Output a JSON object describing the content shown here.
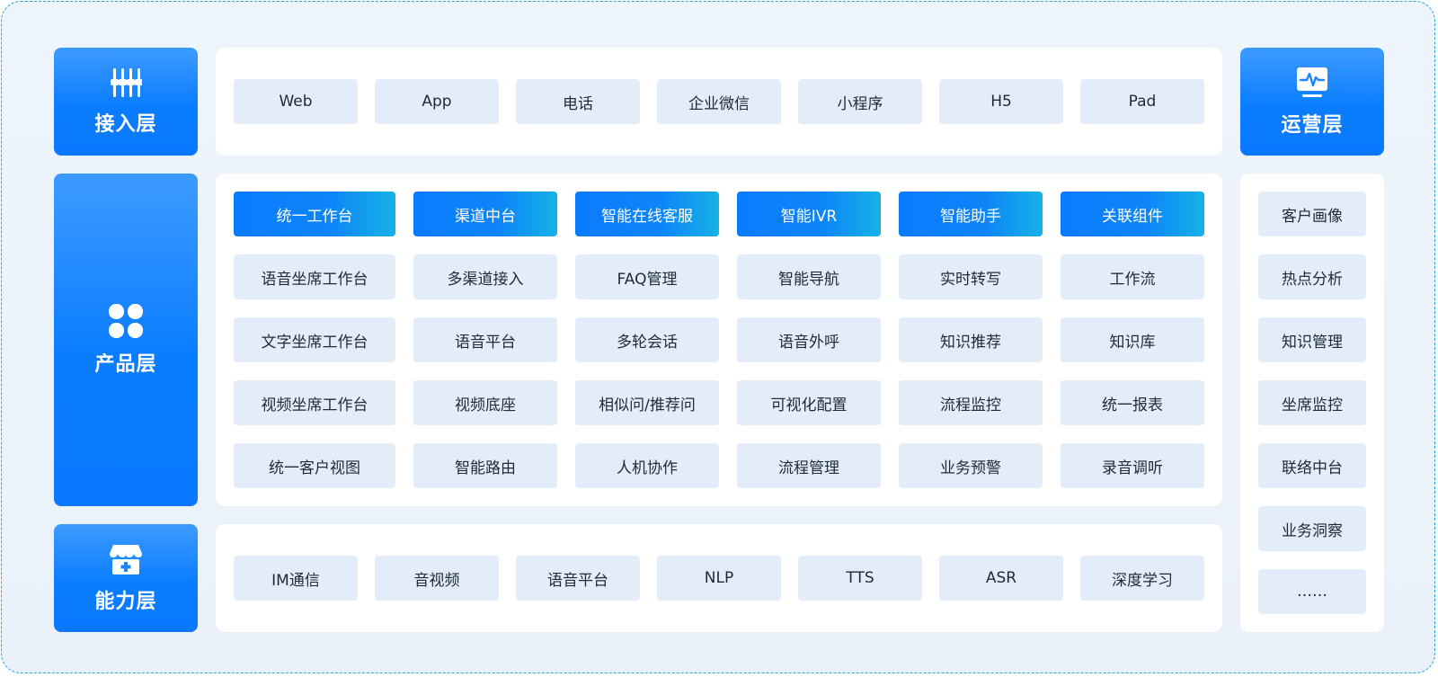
{
  "layers": {
    "access": {
      "label": "接入层",
      "icon": "equalizer-icon"
    },
    "product": {
      "label": "产品层",
      "icon": "four-petal-icon"
    },
    "capability": {
      "label": "能力层",
      "icon": "store-medical-icon"
    },
    "operation": {
      "label": "运营层",
      "icon": "monitor-pulse-icon"
    }
  },
  "access_items": [
    "Web",
    "App",
    "电话",
    "企业微信",
    "小程序",
    "H5",
    "Pad"
  ],
  "product_rows": [
    [
      "统一工作台",
      "渠道中台",
      "智能在线客服",
      "智能IVR",
      "智能助手",
      "关联组件"
    ],
    [
      "语音坐席工作台",
      "多渠道接入",
      "FAQ管理",
      "智能导航",
      "实时转写",
      "工作流"
    ],
    [
      "文字坐席工作台",
      "语音平台",
      "多轮会话",
      "语音外呼",
      "知识推荐",
      "知识库"
    ],
    [
      "视频坐席工作台",
      "视频底座",
      "相似问/推荐问",
      "可视化配置",
      "流程监控",
      "统一报表"
    ],
    [
      "统一客户视图",
      "智能路由",
      "人机协作",
      "流程管理",
      "业务预警",
      "录音调听"
    ]
  ],
  "capability_items": [
    "IM通信",
    "音视频",
    "语音平台",
    "NLP",
    "TTS",
    "ASR",
    "深度学习"
  ],
  "operation_items": [
    "客户画像",
    "热点分析",
    "知识管理",
    "坐席监控",
    "联络中台",
    "业务洞察",
    "……"
  ],
  "colors": {
    "accent": "#0a7dff",
    "cell_bg": "#e3edfa",
    "highlight_end": "#16b2e6",
    "border": "#28a8d8"
  }
}
